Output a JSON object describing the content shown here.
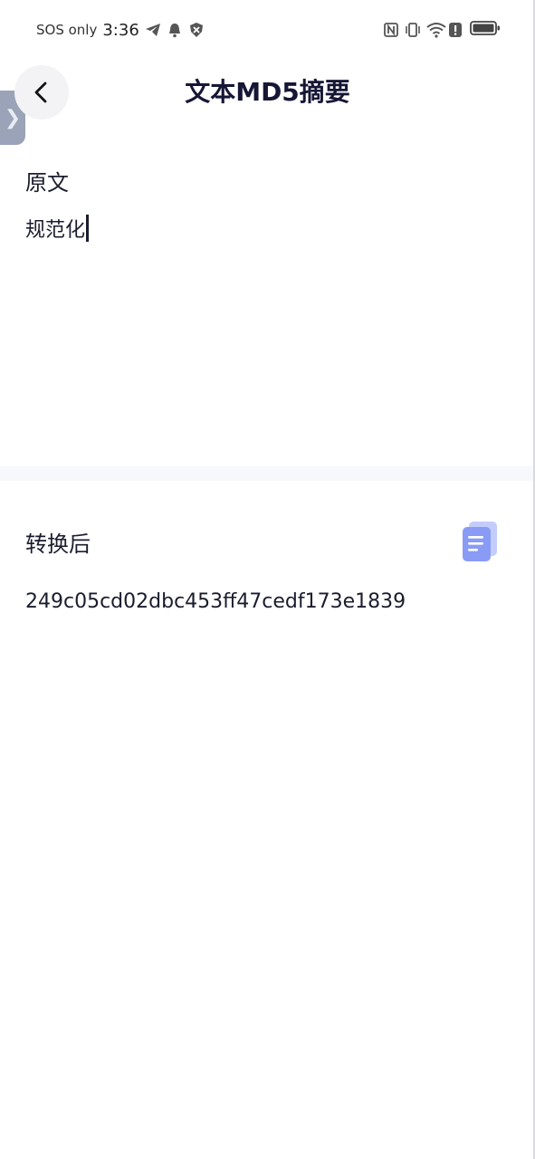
{
  "status_bar": {
    "carrier": "SOS only",
    "time": "3:36",
    "left_icons": [
      "telegram-icon",
      "bell-icon",
      "shield-icon"
    ],
    "right_icons": [
      "nfc-icon",
      "vibrate-icon",
      "wifi-icon",
      "alert-icon",
      "battery-icon"
    ]
  },
  "header": {
    "title": "文本MD5摘要"
  },
  "input_section": {
    "label": "原文",
    "value": "规范化"
  },
  "output_section": {
    "label": "转换后",
    "value": "249c05cd02dbc453ff47cedf173e1839"
  },
  "side_tab": {
    "glyph": "❯"
  },
  "colors": {
    "title": "#161735",
    "copy_icon": "#8a9bf5",
    "divider": "#f7f8fc"
  }
}
